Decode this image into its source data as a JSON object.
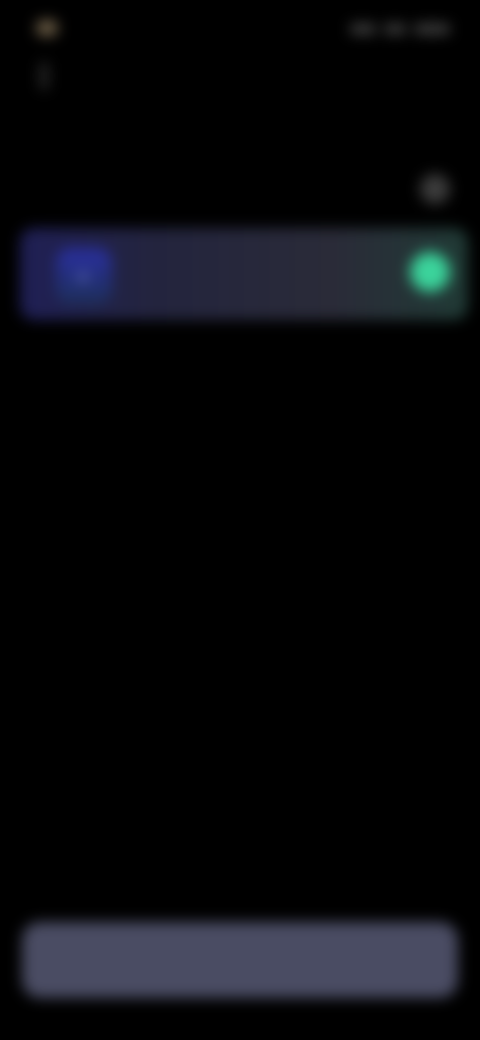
{
  "status_bar": {
    "time": ""
  },
  "header": {
    "title": "",
    "subtitle": ""
  },
  "section": {
    "label": ""
  },
  "card": {
    "label": ""
  },
  "primary_button": {
    "label": ""
  },
  "icons": {
    "back": "back-icon",
    "section": "help-icon",
    "card": "app-icon",
    "selected": "check-icon"
  },
  "colors": {
    "background": "#000000",
    "card_accent": "#2a2fa0",
    "selected": "#3bd39b",
    "button": "#4a4c63"
  }
}
